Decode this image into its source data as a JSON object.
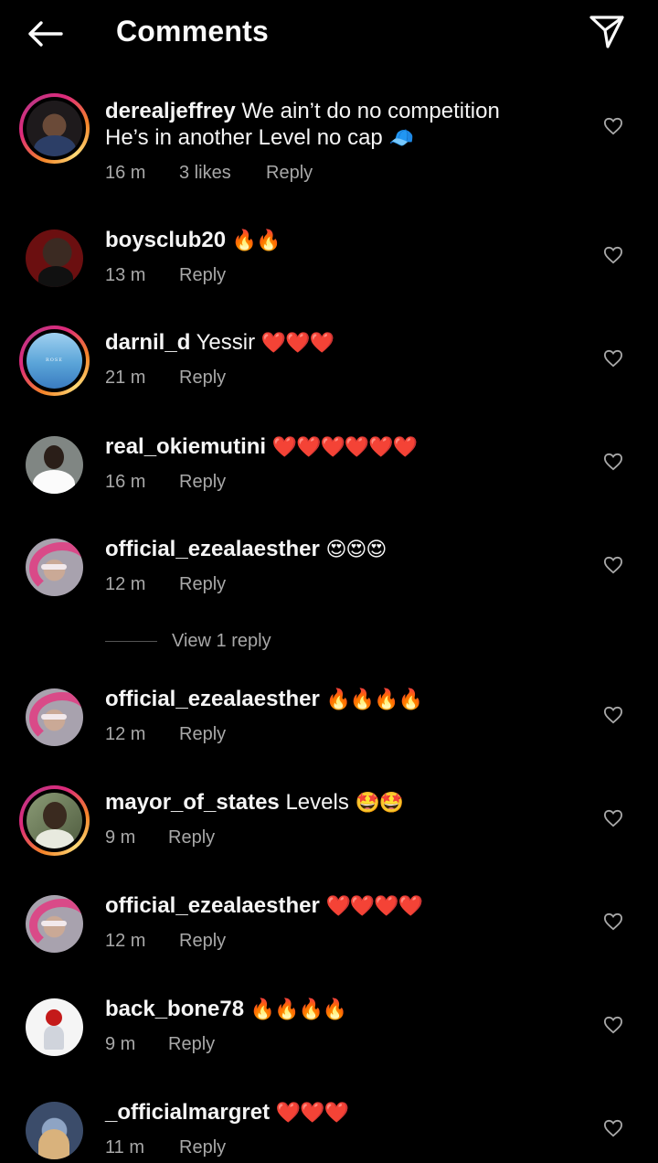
{
  "header": {
    "title": "Comments",
    "back_icon": "arrow-left-icon",
    "send_icon": "paper-plane-icon"
  },
  "colors": {
    "background": "#000000",
    "text": "#f5f5f5",
    "secondary_text": "#a8a8a8",
    "story_ring": [
      "#f58529",
      "#dd2a7b",
      "#feda77"
    ]
  },
  "comments": [
    {
      "username": "derealjeffrey",
      "text": "We ain’t do no competition He’s in another Level no cap",
      "emoji": "🧢",
      "time": "16 m",
      "likes": "3 likes",
      "reply": "Reply",
      "story_ring": true
    },
    {
      "username": "boysclub20",
      "text": "",
      "emoji": "🔥🔥",
      "time": "13 m",
      "reply": "Reply",
      "story_ring": false
    },
    {
      "username": "darnil_d",
      "text": "Yessir",
      "emoji": "❤️❤️❤️",
      "time": "21 m",
      "reply": "Reply",
      "story_ring": true
    },
    {
      "username": "real_okiemutini",
      "text": "",
      "emoji": "❤️❤️❤️❤️❤️❤️",
      "time": "16 m",
      "reply": "Reply",
      "story_ring": false
    },
    {
      "username": "official_ezealaesther",
      "text": "",
      "emoji": "😍😍😍",
      "time": "12 m",
      "reply": "Reply",
      "story_ring": false
    },
    {
      "username": "official_ezealaesther",
      "text": "",
      "emoji": "🔥🔥🔥🔥",
      "time": "12 m",
      "reply": "Reply",
      "story_ring": false
    },
    {
      "username": "mayor_of_states",
      "text": "Levels",
      "emoji": "🤩🤩",
      "time": "9 m",
      "reply": "Reply",
      "story_ring": true
    },
    {
      "username": "official_ezealaesther",
      "text": "",
      "emoji": "❤️❤️❤️❤️",
      "time": "12 m",
      "reply": "Reply",
      "story_ring": false
    },
    {
      "username": "back_bone78",
      "text": "",
      "emoji": "🔥🔥🔥🔥",
      "time": "9 m",
      "reply": "Reply",
      "story_ring": false
    },
    {
      "username": "_officialmargret",
      "text": "",
      "emoji": "❤️❤️❤️",
      "time": "11 m",
      "reply": "Reply",
      "story_ring": false
    }
  ],
  "view_replies": "View 1 reply"
}
